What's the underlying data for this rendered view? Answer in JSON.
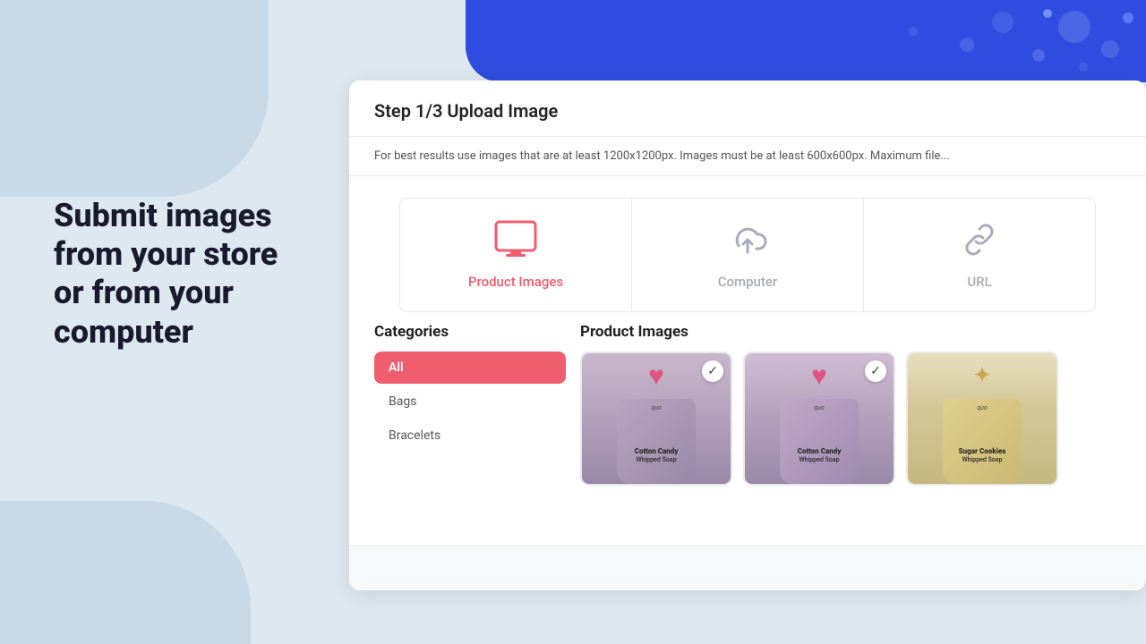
{
  "left": {
    "heading_line1": "Submit images",
    "heading_line2": "from your store",
    "heading_line3": "or from your",
    "heading_line4": "computer"
  },
  "card": {
    "step_label": "Step 1/3 Upload Image",
    "info_text": "For best results use images that are at least 1200x1200px. Images must be at least 600x600px. Maximum file...",
    "upload_options": [
      {
        "id": "product-images",
        "label": "Product Images",
        "active": true
      },
      {
        "id": "computer",
        "label": "Computer",
        "active": false
      }
    ],
    "categories_title": "Categories",
    "categories": [
      {
        "label": "All",
        "active": true
      },
      {
        "label": "Bags",
        "active": false
      },
      {
        "label": "Bracelets",
        "active": false
      }
    ],
    "products_title": "Product Images",
    "products": [
      {
        "name": "Cotton Candy",
        "selected": true,
        "variant": "cotton-candy-1"
      },
      {
        "name": "Cotton Candy",
        "selected": true,
        "variant": "cotton-candy-2"
      },
      {
        "name": "Sugar Cookies",
        "selected": false,
        "variant": "sugar-cookies"
      }
    ]
  },
  "icons": {
    "monitor": "🖥",
    "cloud_upload": "☁",
    "checkmark": "✓",
    "heart": "♥"
  }
}
